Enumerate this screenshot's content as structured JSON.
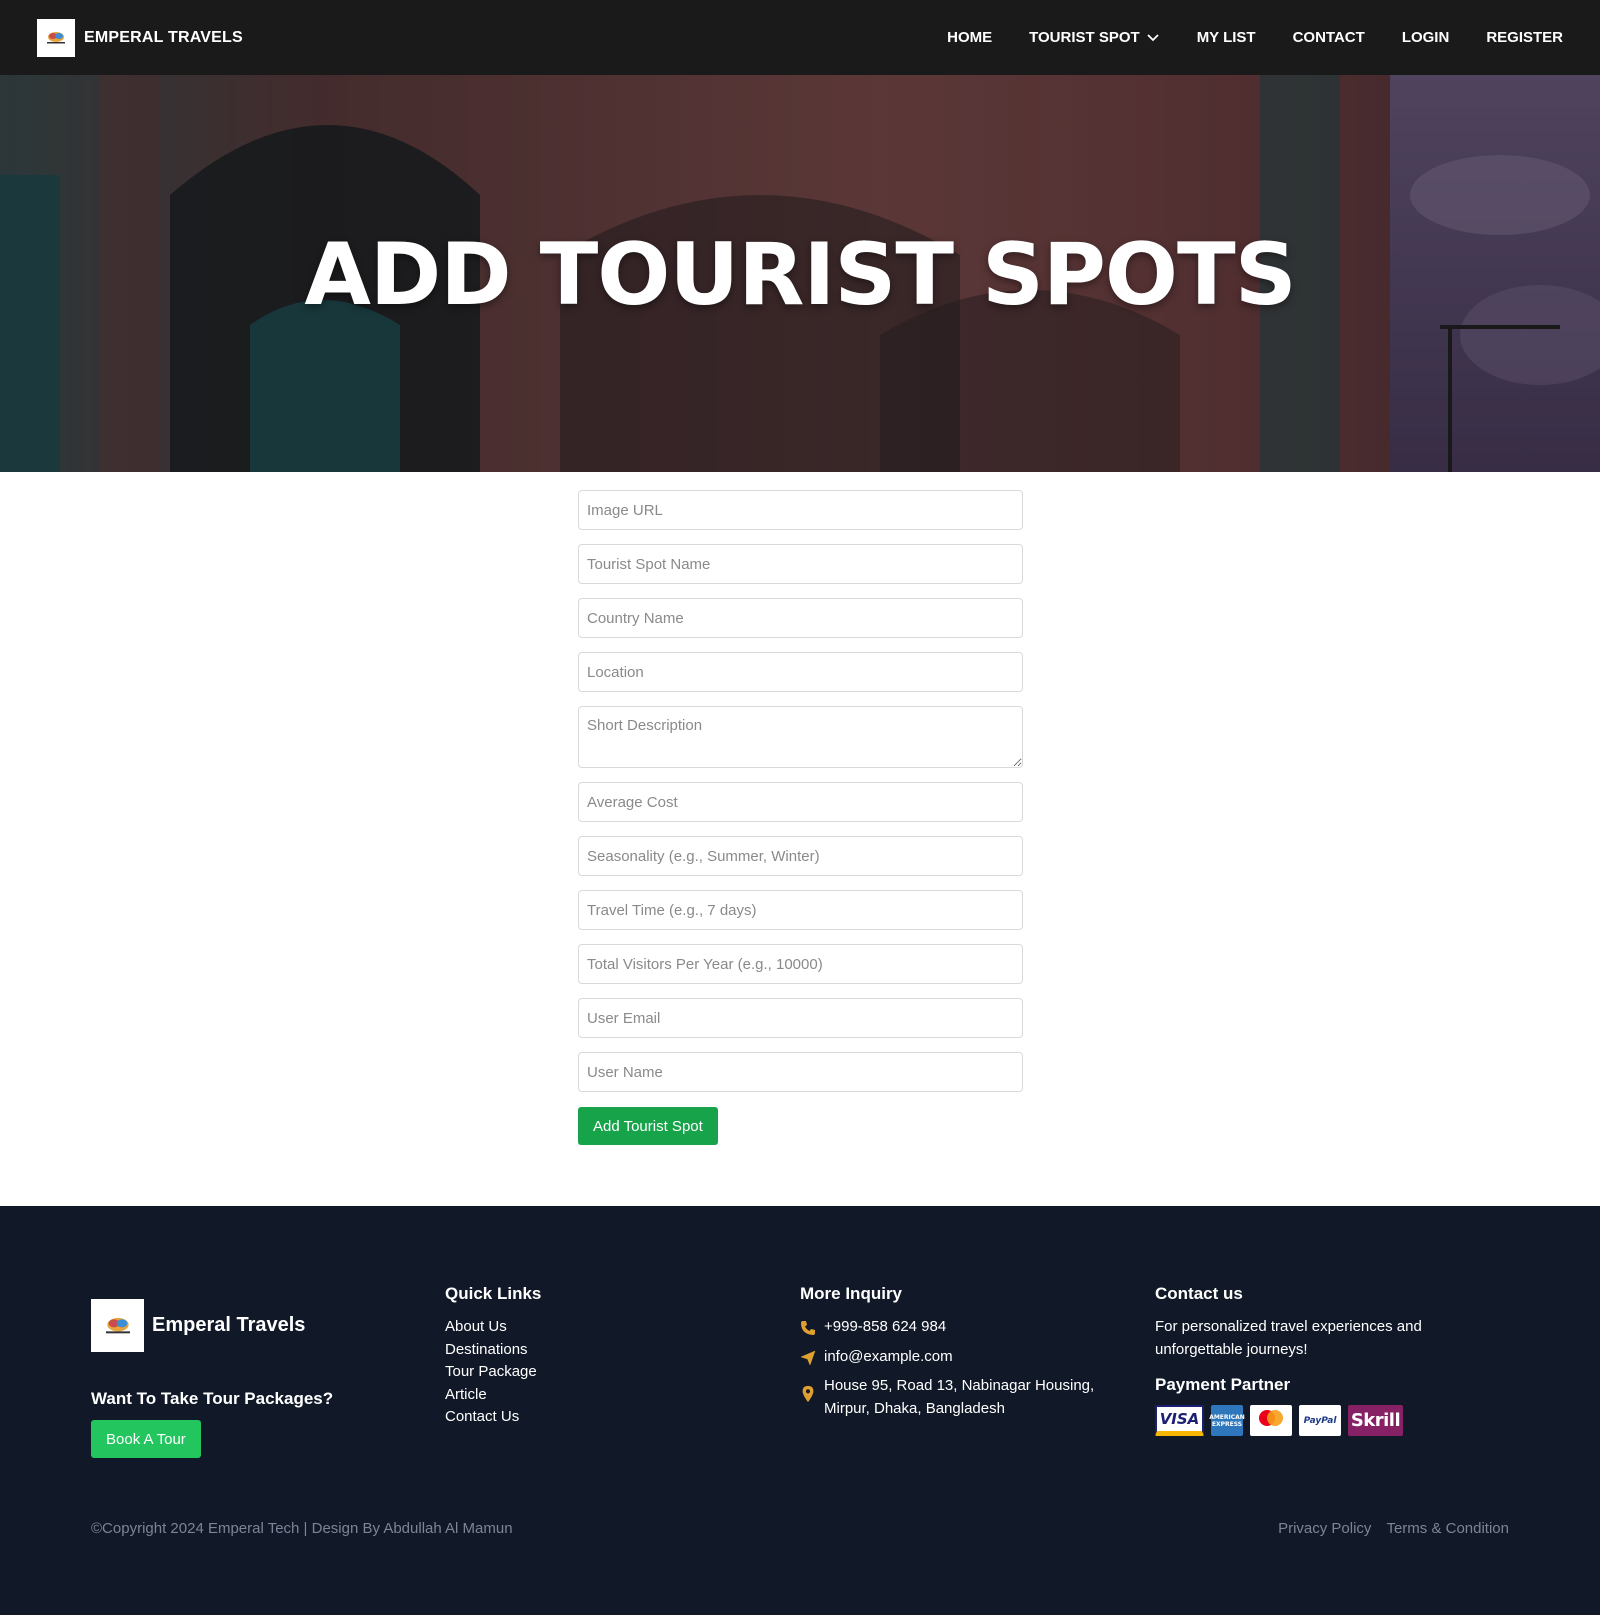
{
  "brand": {
    "name": "EMPERAL TRAVELS"
  },
  "nav": {
    "items": [
      {
        "label": "HOME"
      },
      {
        "label": "TOURIST SPOT",
        "has_dropdown": true
      },
      {
        "label": "MY LIST"
      },
      {
        "label": "CONTACT"
      },
      {
        "label": "LOGIN"
      },
      {
        "label": "REGISTER"
      }
    ]
  },
  "hero": {
    "title": "ADD TOURIST SPOTS"
  },
  "form": {
    "image_url": {
      "placeholder": "Image URL",
      "value": ""
    },
    "spot_name": {
      "placeholder": "Tourist Spot Name",
      "value": ""
    },
    "country": {
      "placeholder": "Country Name",
      "value": ""
    },
    "location": {
      "placeholder": "Location",
      "value": ""
    },
    "description": {
      "placeholder": "Short Description",
      "value": ""
    },
    "avg_cost": {
      "placeholder": "Average Cost",
      "value": ""
    },
    "seasonality": {
      "placeholder": "Seasonality (e.g., Summer, Winter)",
      "value": ""
    },
    "travel_time": {
      "placeholder": "Travel Time (e.g., 7 days)",
      "value": ""
    },
    "visitors": {
      "placeholder": "Total Visitors Per Year (e.g., 10000)",
      "value": ""
    },
    "user_email": {
      "placeholder": "User Email",
      "value": ""
    },
    "user_name": {
      "placeholder": "User Name",
      "value": ""
    },
    "submit_label": "Add Tourist Spot"
  },
  "footer": {
    "brand_name": "Emperal Travels",
    "cta_title": "Want To Take Tour Packages?",
    "cta_button": "Book A Tour",
    "quick_links": {
      "heading": "Quick Links",
      "items": [
        "About Us",
        "Destinations",
        "Tour Package",
        "Article",
        "Contact Us"
      ]
    },
    "inquiry": {
      "heading": "More Inquiry",
      "phone": "+999-858 624 984",
      "email": "info@example.com",
      "address": "House 95, Road 13, Nabinagar Housing, Mirpur, Dhaka, Bangladesh"
    },
    "contact": {
      "heading": "Contact us",
      "text": "For personalized travel experiences and unforgettable journeys!",
      "payment_heading": "Payment Partner",
      "payments": [
        "VISA",
        "AMERICAN EXPRESS",
        "mastercard",
        "PayPal",
        "Skrill"
      ]
    },
    "copyright": "©Copyright 2024 Emperal Tech | Design By Abdullah Al Mamun",
    "bottom_links": [
      "Privacy Policy",
      "Terms & Condition"
    ]
  },
  "colors": {
    "nav_bg": "#1a1a1a",
    "footer_bg": "#111827",
    "primary_button": "#16a34a",
    "cta_button": "#22c55e",
    "icon_accent": "#e0a030"
  },
  "icons": [
    "chevron-down-icon",
    "phone-icon",
    "send-icon",
    "map-pin-icon"
  ]
}
